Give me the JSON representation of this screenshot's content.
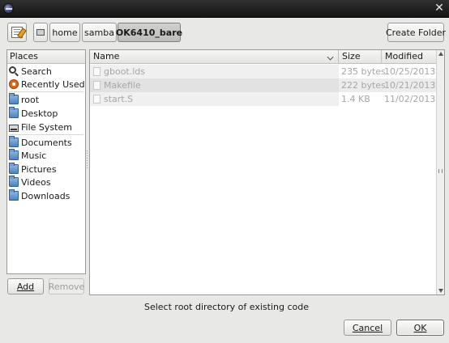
{
  "toolbar": {
    "breadcrumbs": [
      "home",
      "samba",
      "OK6410_bare"
    ],
    "create_folder_label": "Create Folder"
  },
  "places": {
    "header": "Places",
    "items": [
      {
        "label": "Search",
        "icon": "search-icon"
      },
      {
        "label": "Recently Used",
        "icon": "recent-icon"
      },
      {
        "label": "root",
        "icon": "folder-icon"
      },
      {
        "label": "Desktop",
        "icon": "folder-icon"
      },
      {
        "label": "File System",
        "icon": "drive-icon"
      },
      {
        "label": "Documents",
        "icon": "folder-icon"
      },
      {
        "label": "Music",
        "icon": "folder-icon"
      },
      {
        "label": "Pictures",
        "icon": "folder-icon"
      },
      {
        "label": "Videos",
        "icon": "folder-icon"
      },
      {
        "label": "Downloads",
        "icon": "folder-icon"
      }
    ],
    "add_label": "Add",
    "remove_label": "Remove"
  },
  "files": {
    "columns": {
      "name": "Name",
      "size": "Size",
      "modified": "Modified"
    },
    "rows": [
      {
        "name": "gboot.lds",
        "size": "235 bytes",
        "modified": "10/25/2013"
      },
      {
        "name": "Makefile",
        "size": "222 bytes",
        "modified": "10/21/2013"
      },
      {
        "name": "start.S",
        "size": "1.4 KB",
        "modified": "11/02/2013"
      }
    ]
  },
  "status": "Select root directory of existing code",
  "actions": {
    "cancel_label": "Cancel",
    "ok_label": "OK"
  }
}
